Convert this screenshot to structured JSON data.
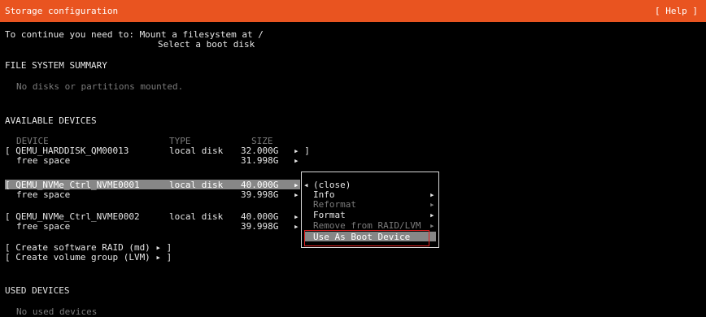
{
  "header": {
    "title": "Storage configuration",
    "help": "[ Help ]"
  },
  "intro": {
    "line1": "To continue you need to: Mount a filesystem at /",
    "line2": "Select a boot disk"
  },
  "fs_summary": {
    "heading": "FILE SYSTEM SUMMARY",
    "empty": "No disks or partitions mounted."
  },
  "available": {
    "heading": "AVAILABLE DEVICES",
    "columns": {
      "device": "DEVICE",
      "type": "TYPE",
      "size": "SIZE"
    },
    "devices": [
      {
        "name": "[ QEMU_HARDDISK_QM00013",
        "type": "local disk",
        "size": "32.000G",
        "action": "▸ ]",
        "free_label": "free space",
        "free_size": "31.998G",
        "free_arrow": "▸"
      },
      {
        "name": "[ QEMU_NVMe_Ctrl_NVME0001",
        "type": "local disk",
        "size": "40.000G",
        "action": "▸",
        "free_label": "free space",
        "free_size": "39.998G",
        "free_arrow": "▸"
      },
      {
        "name": "[ QEMU_NVMe_Ctrl_NVME0002",
        "type": "local disk",
        "size": "40.000G",
        "action": "▸",
        "free_label": "free space",
        "free_size": "39.998G",
        "free_arrow": "▸"
      }
    ],
    "create_raid": "[ Create software RAID (md) ▸ ]",
    "create_lvm": "[ Create volume group (LVM) ▸ ]"
  },
  "context_menu": {
    "open_marker": "◂",
    "items": [
      {
        "label": "(close)",
        "arrow": "",
        "enabled": true
      },
      {
        "label": "Info",
        "arrow": "▸",
        "enabled": true
      },
      {
        "label": "Reformat",
        "arrow": "▸",
        "enabled": false
      },
      {
        "label": "Format",
        "arrow": "▸",
        "enabled": true
      },
      {
        "label": "Remove from RAID/LVM",
        "arrow": "▸",
        "enabled": false
      },
      {
        "label": "Use As Boot Device",
        "arrow": "",
        "enabled": true,
        "selected": true
      }
    ]
  },
  "used": {
    "heading": "USED DEVICES",
    "empty": "No used devices"
  },
  "colors": {
    "accent": "#e95420",
    "selection": "#878787",
    "highlight_box": "#e02020",
    "background": "#000000"
  }
}
